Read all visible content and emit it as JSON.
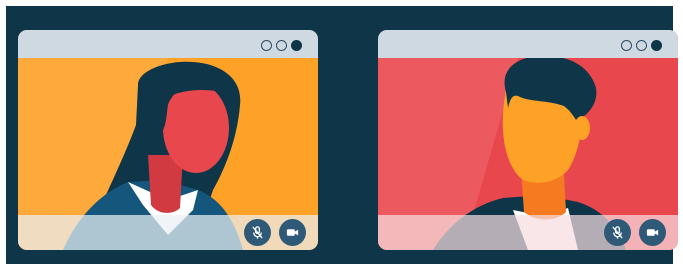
{
  "windows": [
    {
      "id": "left",
      "background": "#fea127",
      "person": "woman",
      "controls": [
        "mute-microphone-icon",
        "video-camera-icon"
      ],
      "window_dots": [
        "hollow",
        "hollow",
        "filled"
      ]
    },
    {
      "id": "right",
      "background": "#e8474d",
      "person": "man",
      "controls": [
        "mute-microphone-icon",
        "video-camera-icon"
      ],
      "window_dots": [
        "hollow",
        "hollow",
        "filled"
      ]
    }
  ],
  "colors": {
    "frame_background": "#0e3548",
    "titlebar": "#cfd9e1",
    "control_button": "#2e5a78"
  }
}
